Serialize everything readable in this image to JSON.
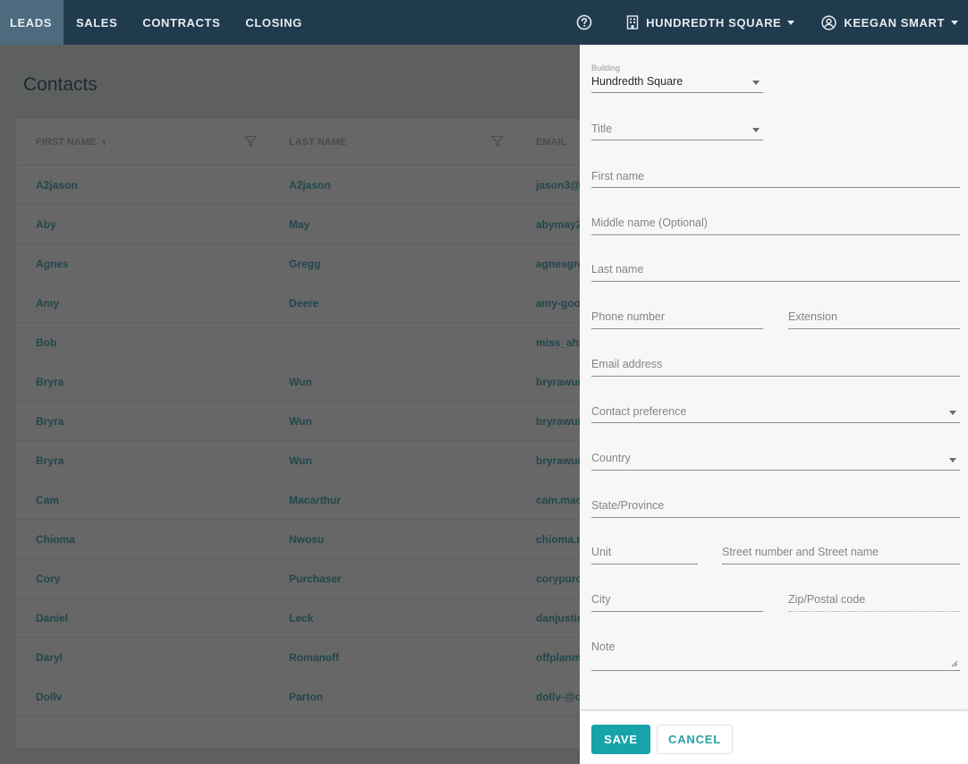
{
  "nav": {
    "tabs": [
      {
        "label": "LEADS",
        "active": true
      },
      {
        "label": "SALES",
        "active": false
      },
      {
        "label": "CONTRACTS",
        "active": false
      },
      {
        "label": "CLOSING",
        "active": false
      }
    ],
    "help_icon": "help-circle-icon",
    "building_menu": {
      "icon": "building-icon",
      "label": "HUNDREDTH SQUARE"
    },
    "user_menu": {
      "icon": "user-circle-icon",
      "label": "KEEGAN SMART"
    }
  },
  "page": {
    "title": "Contacts",
    "table": {
      "columns": [
        {
          "label": "FIRST NAME",
          "sort": "ascending",
          "filter": true
        },
        {
          "label": "LAST NAME",
          "filter": true
        },
        {
          "label": "EMAIL"
        }
      ],
      "rows": [
        {
          "first": "A2jason",
          "last": "A2jason",
          "email": "jason3@"
        },
        {
          "first": "Aby",
          "last": "May",
          "email": "abymay2"
        },
        {
          "first": "Agnes",
          "last": "Gregg",
          "email": "agnesgre"
        },
        {
          "first": "Amy",
          "last": "Deere",
          "email": "amy-goo"
        },
        {
          "first": "Bob",
          "last": "",
          "email": "miss_ahr"
        },
        {
          "first": "Bryra",
          "last": "Wun",
          "email": "bryrawun"
        },
        {
          "first": "Bryra",
          "last": "Wun",
          "email": "bryrawun"
        },
        {
          "first": "Bryra",
          "last": "Wun",
          "email": "bryrawun"
        },
        {
          "first": "Cam",
          "last": "Macarthur",
          "email": "cam.mac"
        },
        {
          "first": "Chioma",
          "last": "Nwosu",
          "email": "chioma.r"
        },
        {
          "first": "Cory",
          "last": "Purchaser",
          "email": "corypurc"
        },
        {
          "first": "Daniel",
          "last": "Leck",
          "email": "danjustin"
        },
        {
          "first": "Daryl",
          "last": "Romanoff",
          "email": "offplanm"
        },
        {
          "first": "Dollv",
          "last": "Parton",
          "email": "dollv-@o"
        }
      ]
    }
  },
  "form": {
    "building": {
      "label": "Building",
      "value": "Hundredth Square"
    },
    "title": {
      "label": "Title"
    },
    "first_name": {
      "label": "First name"
    },
    "middle_name": {
      "label": "Middle name (Optional)"
    },
    "last_name": {
      "label": "Last name"
    },
    "phone": {
      "label": "Phone number"
    },
    "extension": {
      "label": "Extension"
    },
    "email": {
      "label": "Email address"
    },
    "contact_preference": {
      "label": "Contact preference"
    },
    "country": {
      "label": "Country"
    },
    "state": {
      "label": "State/Province"
    },
    "unit": {
      "label": "Unit"
    },
    "street": {
      "label": "Street number and Street name"
    },
    "city": {
      "label": "City"
    },
    "zip": {
      "label": "Zip/Postal code"
    },
    "note": {
      "label": "Note"
    },
    "save_label": "SAVE",
    "cancel_label": "CANCEL"
  },
  "colors": {
    "topbar": "#203a4e",
    "active_tab": "#4d6a7e",
    "accent": "#18a3ab",
    "link_text": "#21474c"
  }
}
